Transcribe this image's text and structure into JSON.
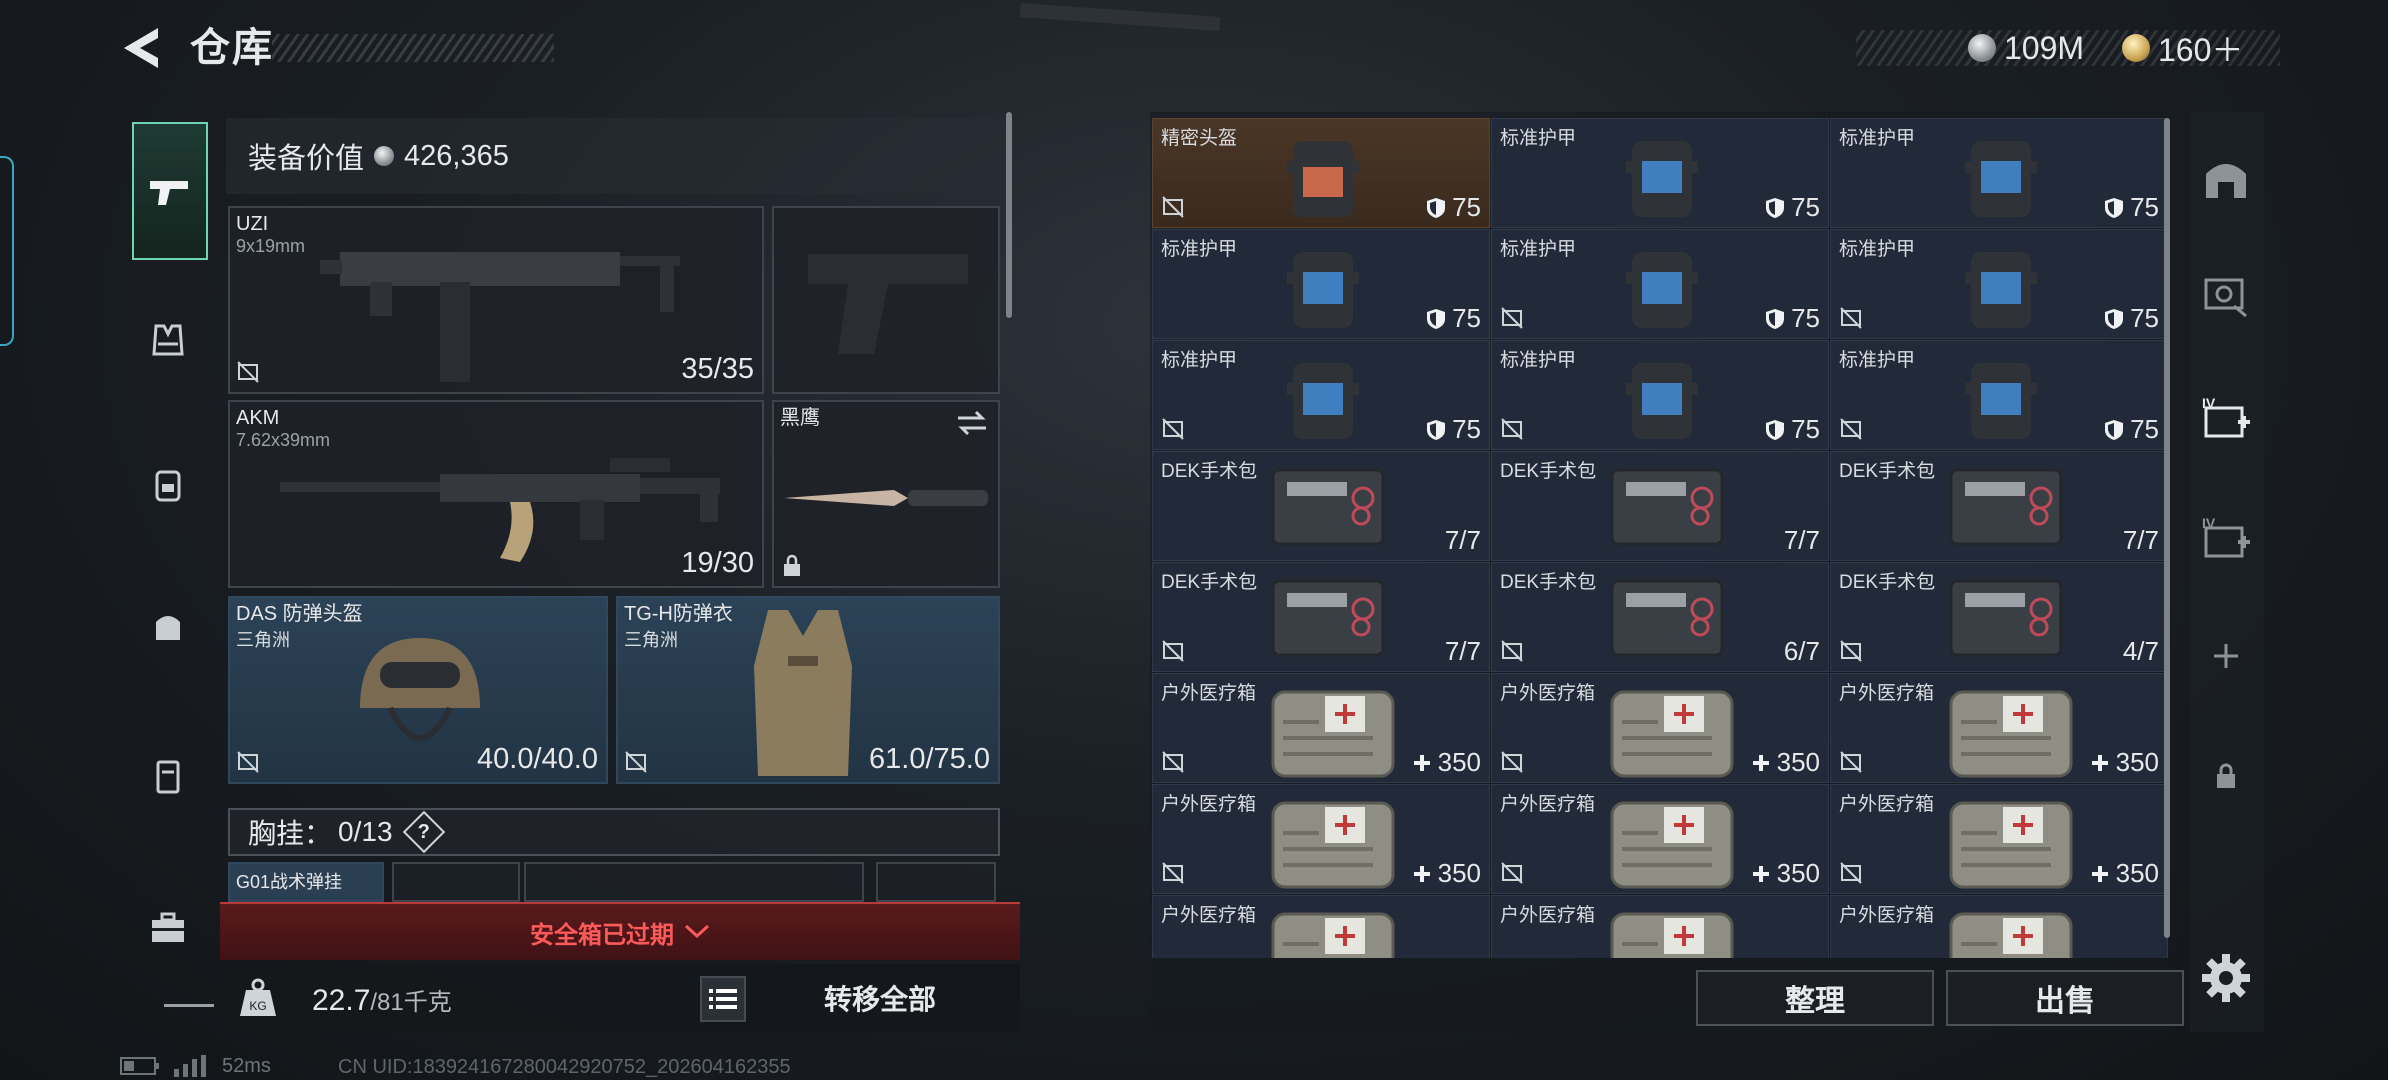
{
  "header": {
    "title": "仓库",
    "currency_silver": "109M",
    "currency_gold": "160＋"
  },
  "loadout": {
    "equip_value_label": "装备价值",
    "equip_value": "426,365",
    "primary_1": {
      "name": "UZI",
      "caliber": "9x19mm",
      "ammo": "35/35"
    },
    "primary_2": {
      "name": "AKM",
      "caliber": "7.62x39mm",
      "ammo": "19/30"
    },
    "melee": {
      "name": "黑鹰"
    },
    "helmet": {
      "name": "DAS 防弹头盔",
      "faction": "三角洲",
      "durability": "40.0/40.0"
    },
    "armor": {
      "name": "TG-H防弹衣",
      "faction": "三角洲",
      "durability": "61.0/75.0"
    },
    "vest_label": "胸挂：",
    "vest_count": "0/13",
    "vest_help": "?",
    "vest_slot_1": "G01战术弹挂",
    "safe_box_expired": "安全箱已过期",
    "weight": "22.7",
    "weight_max": "/81千克",
    "transfer_all": "转移全部"
  },
  "inventory": {
    "rows": [
      [
        {
          "name": "精密头盔",
          "value": "75",
          "kind": "helmet",
          "highlight": true,
          "nosell": true
        },
        {
          "name": "标准护甲",
          "value": "75",
          "kind": "armor",
          "nosell": false
        },
        {
          "name": "标准护甲",
          "value": "75",
          "kind": "armor",
          "nosell": false
        }
      ],
      [
        {
          "name": "标准护甲",
          "value": "75",
          "kind": "armor",
          "nosell": false
        },
        {
          "name": "标准护甲",
          "value": "75",
          "kind": "armor",
          "nosell": true
        },
        {
          "name": "标准护甲",
          "value": "75",
          "kind": "armor",
          "nosell": true
        }
      ],
      [
        {
          "name": "标准护甲",
          "value": "75",
          "kind": "armor",
          "nosell": true
        },
        {
          "name": "标准护甲",
          "value": "75",
          "kind": "armor",
          "nosell": true
        },
        {
          "name": "标准护甲",
          "value": "75",
          "kind": "armor",
          "nosell": true
        }
      ],
      [
        {
          "name": "DEK手术包",
          "value": "7/7",
          "kind": "surgery",
          "nosell": false
        },
        {
          "name": "DEK手术包",
          "value": "7/7",
          "kind": "surgery",
          "nosell": false
        },
        {
          "name": "DEK手术包",
          "value": "7/7",
          "kind": "surgery",
          "nosell": false
        }
      ],
      [
        {
          "name": "DEK手术包",
          "value": "7/7",
          "kind": "surgery",
          "nosell": true
        },
        {
          "name": "DEK手术包",
          "value": "6/7",
          "kind": "surgery",
          "nosell": true
        },
        {
          "name": "DEK手术包",
          "value": "4/7",
          "kind": "surgery",
          "nosell": true
        }
      ],
      [
        {
          "name": "户外医疗箱",
          "value": "350",
          "kind": "medkit",
          "nosell": true
        },
        {
          "name": "户外医疗箱",
          "value": "350",
          "kind": "medkit",
          "nosell": true
        },
        {
          "name": "户外医疗箱",
          "value": "350",
          "kind": "medkit",
          "nosell": true
        }
      ],
      [
        {
          "name": "户外医疗箱",
          "value": "350",
          "kind": "medkit",
          "nosell": true
        },
        {
          "name": "户外医疗箱",
          "value": "350",
          "kind": "medkit",
          "nosell": true
        },
        {
          "name": "户外医疗箱",
          "value": "350",
          "kind": "medkit",
          "nosell": true
        }
      ],
      [
        {
          "name": "户外医疗箱",
          "value": "",
          "kind": "medkit",
          "nosell": false
        },
        {
          "name": "户外医疗箱",
          "value": "",
          "kind": "medkit",
          "nosell": false
        },
        {
          "name": "户外医疗箱",
          "value": "",
          "kind": "medkit",
          "nosell": false
        }
      ]
    ],
    "sort_label": "整理",
    "sell_label": "出售"
  },
  "right_nav": {
    "tab_3_label": "IV",
    "tab_4_label": "IV"
  },
  "status": {
    "ping": "52ms",
    "uid": "CN UID:1839241672800429​20752_202604162355"
  },
  "colors": {
    "accent_green": "#6fd5b0",
    "alert_red": "#ff5a5a",
    "item_cell": "#222a3a",
    "highlight_cell": "#4a3626"
  }
}
